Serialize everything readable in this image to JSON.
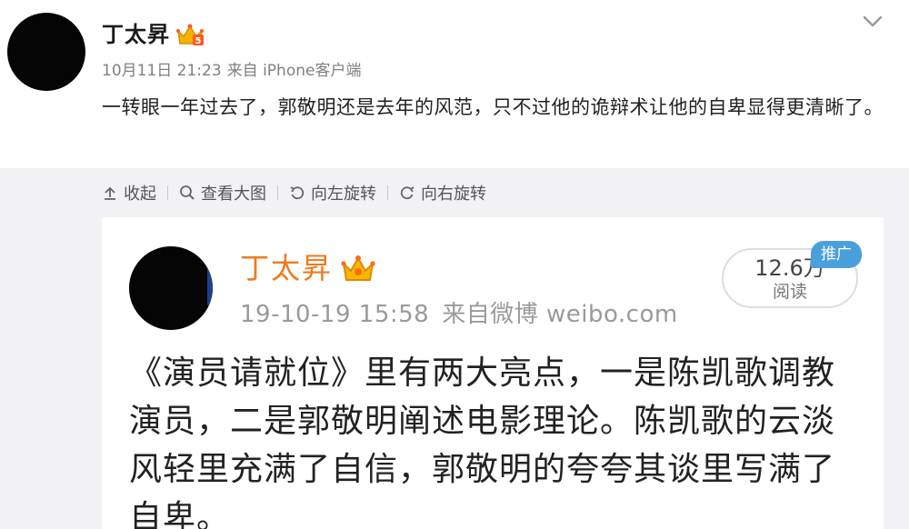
{
  "post": {
    "author": "丁太昇",
    "date": "10月11日 21:23",
    "source": "来自 iPhone客户端",
    "text": "一转眼一年过去了，郭敬明还是去年的风范，只不过他的诡辩术让他的自卑显得更清晰了。"
  },
  "toolbar": {
    "collapse": "收起",
    "view_large": "查看大图",
    "rotate_left": "向左旋转",
    "rotate_right": "向右旋转"
  },
  "embedded": {
    "author": "丁太昇",
    "datetime": "19-10-19 15:58",
    "source": "来自微博 weibo.com",
    "views_count": "12.6万",
    "views_label": "阅读",
    "promo_tag": "推广",
    "text": "《演员请就位》里有两大亮点，一是陈凯歌调教演员，二是郭敬明阐述电影理论。陈凯歌的云淡风轻里充满了自信，郭敬明的夸夸其谈里写满了自卑。"
  },
  "colors": {
    "inner_name": "#f07a1c",
    "promo_tag": "#4aa0dc",
    "background_grey": "#f2f2f5"
  },
  "icons": [
    "vip-badge-icon",
    "chevron-down-icon",
    "collapse-icon",
    "search-icon",
    "rotate-left-icon",
    "rotate-right-icon",
    "crown-icon"
  ]
}
